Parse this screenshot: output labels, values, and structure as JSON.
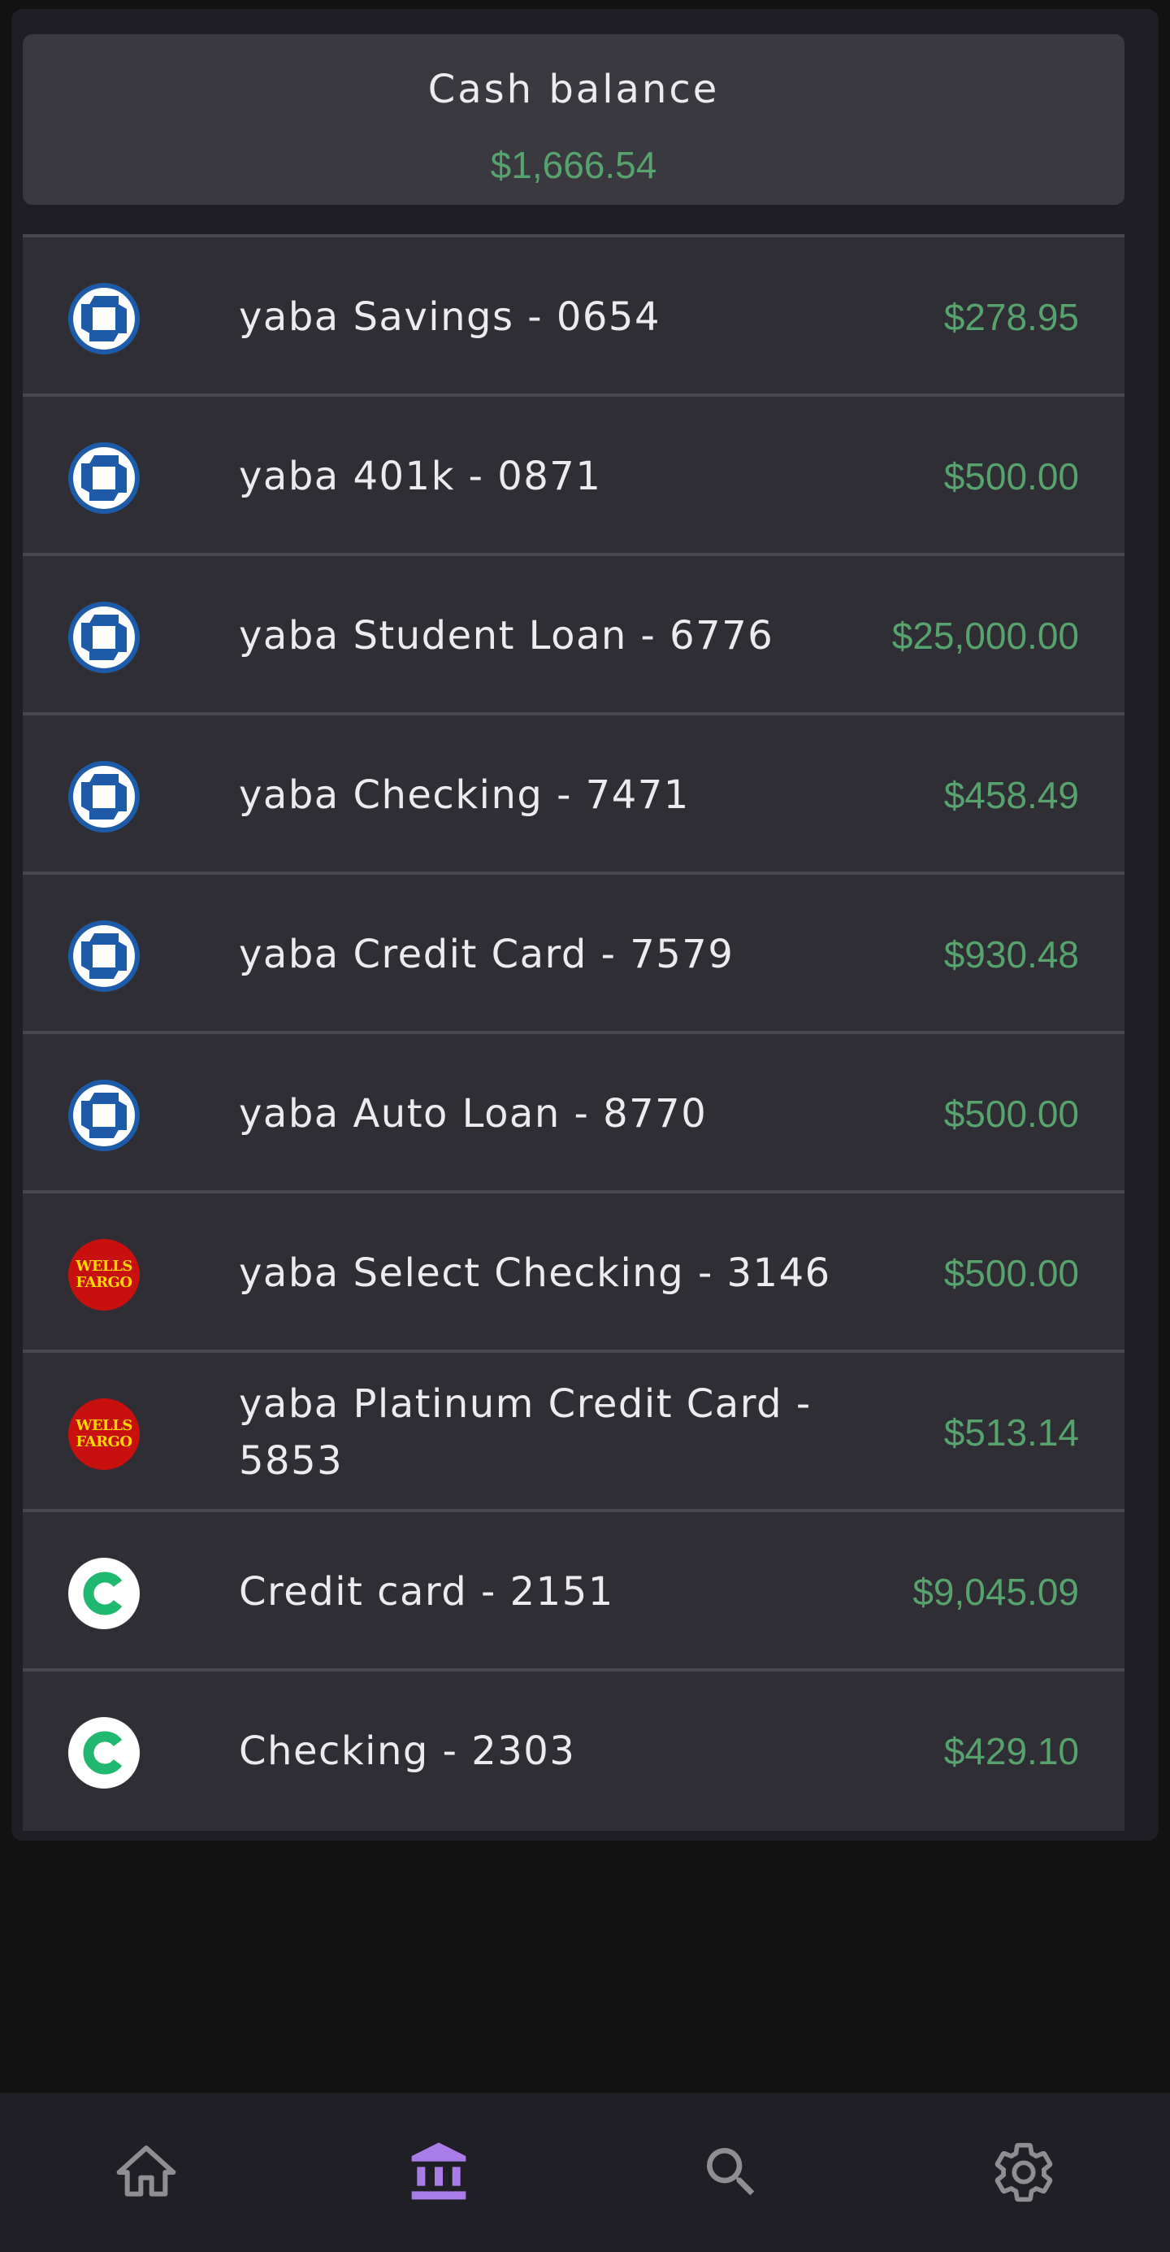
{
  "balance": {
    "title": "Cash balance",
    "value": "$1,666.54"
  },
  "accounts": [
    {
      "name": "yaba Savings - 0654",
      "amount": "$278.95",
      "logo": "chase-logo-icon"
    },
    {
      "name": "yaba 401k - 0871",
      "amount": "$500.00",
      "logo": "chase-logo-icon"
    },
    {
      "name": "yaba Student Loan - 6776",
      "amount": "$25,000.00",
      "logo": "chase-logo-icon"
    },
    {
      "name": "yaba Checking - 7471",
      "amount": "$458.49",
      "logo": "chase-logo-icon"
    },
    {
      "name": "yaba Credit Card - 7579",
      "amount": "$930.48",
      "logo": "chase-logo-icon"
    },
    {
      "name": "yaba Auto Loan - 8770",
      "amount": "$500.00",
      "logo": "chase-logo-icon"
    },
    {
      "name": "yaba Select Checking - 3146",
      "amount": "$500.00",
      "logo": "wells-fargo-logo-icon",
      "logo_text_1": "WELLS",
      "logo_text_2": "FARGO"
    },
    {
      "name": "yaba Platinum Credit Card - 5853",
      "amount": "$513.14",
      "logo": "wells-fargo-logo-icon",
      "logo_text_1": "WELLS",
      "logo_text_2": "FARGO"
    },
    {
      "name": "Credit card - 2151",
      "amount": "$9,045.09",
      "logo": "c-logo-icon"
    },
    {
      "name": "Checking - 2303",
      "amount": "$429.10",
      "logo": "c-logo-icon"
    }
  ],
  "nav": {
    "items": [
      {
        "icon": "home-icon",
        "active": false
      },
      {
        "icon": "bank-icon",
        "active": true
      },
      {
        "icon": "search-icon",
        "active": false
      },
      {
        "icon": "settings-gear-icon",
        "active": false
      }
    ],
    "active_color": "#a97ce8",
    "inactive_color": "#8f8e93"
  },
  "colors": {
    "amount": "#57a36d",
    "chase_blue": "#1d5ba8",
    "wells_red": "#c8100f",
    "wells_yellow": "#ffd800",
    "c_green": "#1fb86e"
  }
}
